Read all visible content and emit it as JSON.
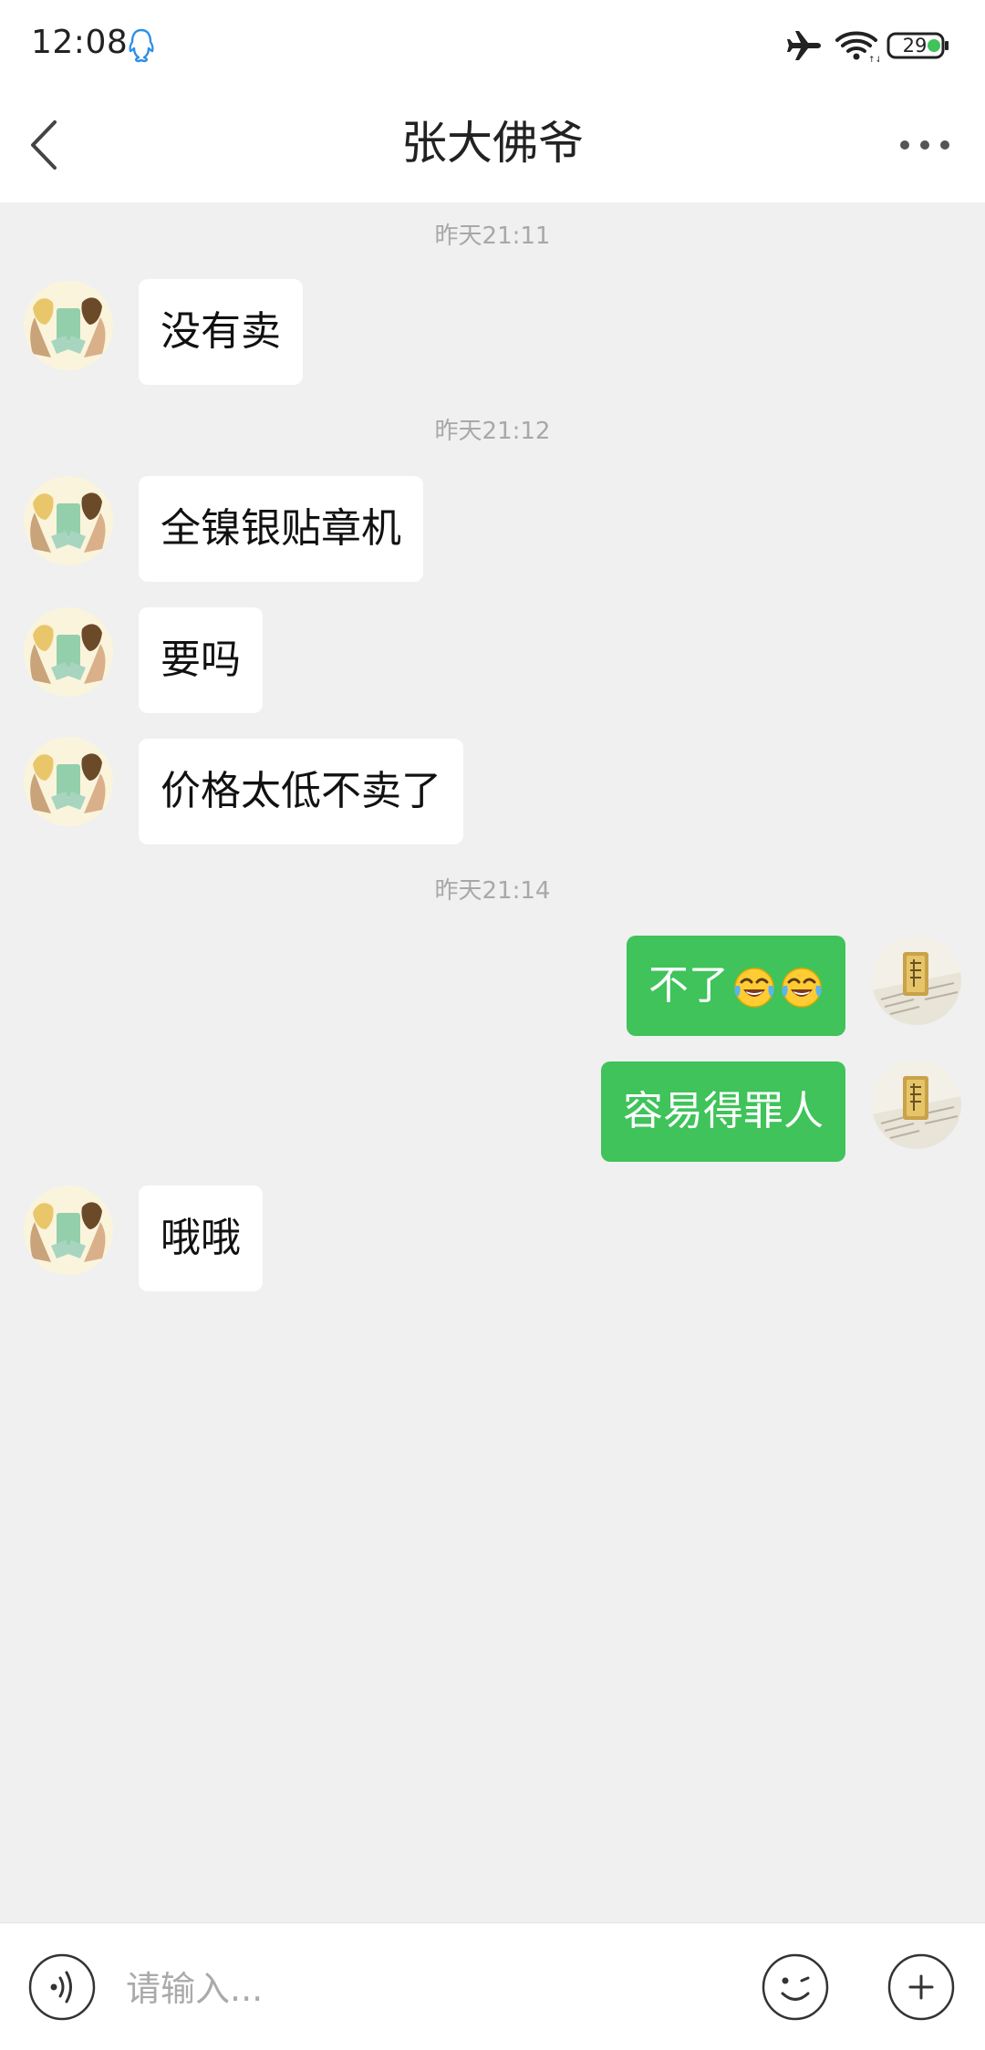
{
  "status": {
    "time": "12:08",
    "battery_level": "29",
    "icons": [
      "qq-icon",
      "airplane-mode-icon",
      "wifi-icon",
      "battery-icon"
    ]
  },
  "header": {
    "title": "张大佛爷",
    "icons": [
      "back-arrow-icon",
      "more-options-icon"
    ]
  },
  "messages": {
    "ts1": "昨天21:11",
    "m1": "没有卖",
    "ts2": "昨天21:12",
    "m2": "全镍银贴章机",
    "m3": "要吗",
    "m4": "价格太低不卖了",
    "ts3": "昨天21:14",
    "m5_text": "不了",
    "m5_emoji": [
      "tears-of-joy-emoji",
      "tears-of-joy-emoji"
    ],
    "m6": "容易得罪人",
    "m7": "哦哦"
  },
  "input_bar": {
    "placeholder": "请输入...",
    "icons": [
      "voice-icon",
      "emoji-icon",
      "plus-icon"
    ]
  },
  "colors": {
    "outgoing_bubble": "#3fc35a",
    "incoming_bubble": "#ffffff",
    "background": "#f0f0f0"
  }
}
